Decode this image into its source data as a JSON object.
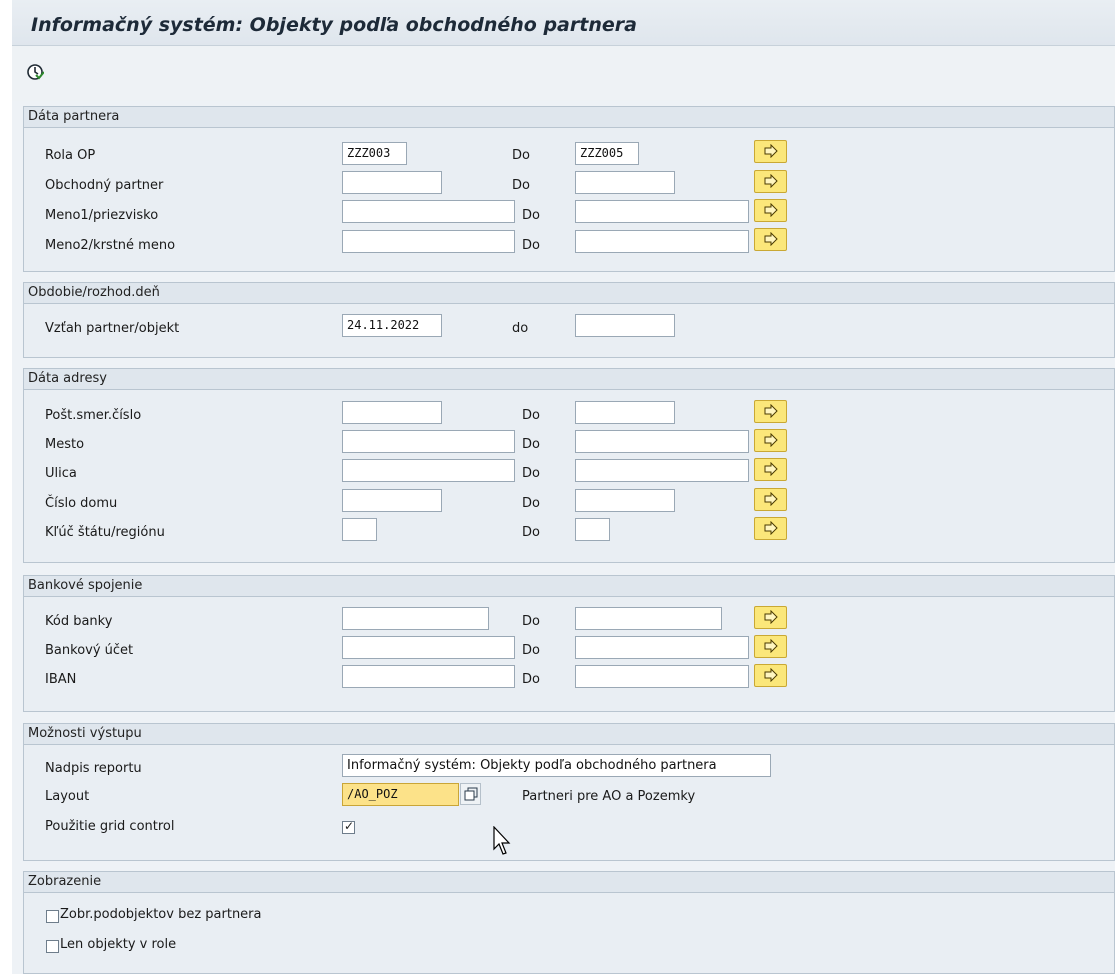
{
  "window": {
    "title": "Informačný systém: Objekty podľa obchodného partnera"
  },
  "toolbar": {
    "execute_icon": "execute-clock-icon"
  },
  "partner_data": {
    "title": "Dáta partnera",
    "rows": [
      {
        "label": "Rola OP",
        "from": "ZZZ003",
        "to_label": "Do",
        "to": "ZZZ005"
      },
      {
        "label": "Obchodný partner",
        "from": "",
        "to_label": "Do",
        "to": ""
      },
      {
        "label": "Meno1/priezvisko",
        "from": "",
        "to_label": "Do",
        "to": ""
      },
      {
        "label": "Meno2/krstné meno",
        "from": "",
        "to_label": "Do",
        "to": ""
      }
    ]
  },
  "period": {
    "title": "Obdobie/rozhod.deň",
    "rows": [
      {
        "label": "Vzťah partner/objekt",
        "from": "24.11.2022",
        "to_label": "do",
        "to": ""
      }
    ]
  },
  "address": {
    "title": "Dáta adresy",
    "rows": [
      {
        "label": "Pošt.smer.číslo",
        "from": "",
        "to_label": "Do",
        "to": ""
      },
      {
        "label": "Mesto",
        "from": "",
        "to_label": "Do",
        "to": ""
      },
      {
        "label": "Ulica",
        "from": "",
        "to_label": "Do",
        "to": ""
      },
      {
        "label": "Číslo domu",
        "from": "",
        "to_label": "Do",
        "to": ""
      },
      {
        "label": "Kľúč štátu/regiónu",
        "from": "",
        "to_label": "Do",
        "to": ""
      }
    ]
  },
  "bank": {
    "title": "Bankové spojenie",
    "rows": [
      {
        "label": "Kód banky",
        "from": "",
        "to_label": "Do",
        "to": ""
      },
      {
        "label": "Bankový účet",
        "from": "",
        "to_label": "Do",
        "to": ""
      },
      {
        "label": "IBAN",
        "from": "",
        "to_label": "Do",
        "to": ""
      }
    ]
  },
  "output": {
    "title": "Možnosti výstupu",
    "report_title_label": "Nadpis reportu",
    "report_title_value": "Informačný systém: Objekty podľa obchodného partnera",
    "layout_label": "Layout",
    "layout_value": "/AO_POZ",
    "layout_description": "Partneri pre AO a Pozemky",
    "grid_label": "Použitie grid control",
    "grid_checked": true,
    "grid_mark": "✓"
  },
  "display": {
    "title": "Zobrazenie",
    "options": [
      {
        "label": "Zobr.podobjektov bez partnera",
        "checked": false
      },
      {
        "label": "Len objekty v role",
        "checked": false
      }
    ]
  },
  "colors": {
    "accent_yellow": "#fbe77a",
    "highlight_field": "#fce289",
    "header_bg": "#dfe6ed",
    "panel_bg": "#e9eef3"
  }
}
